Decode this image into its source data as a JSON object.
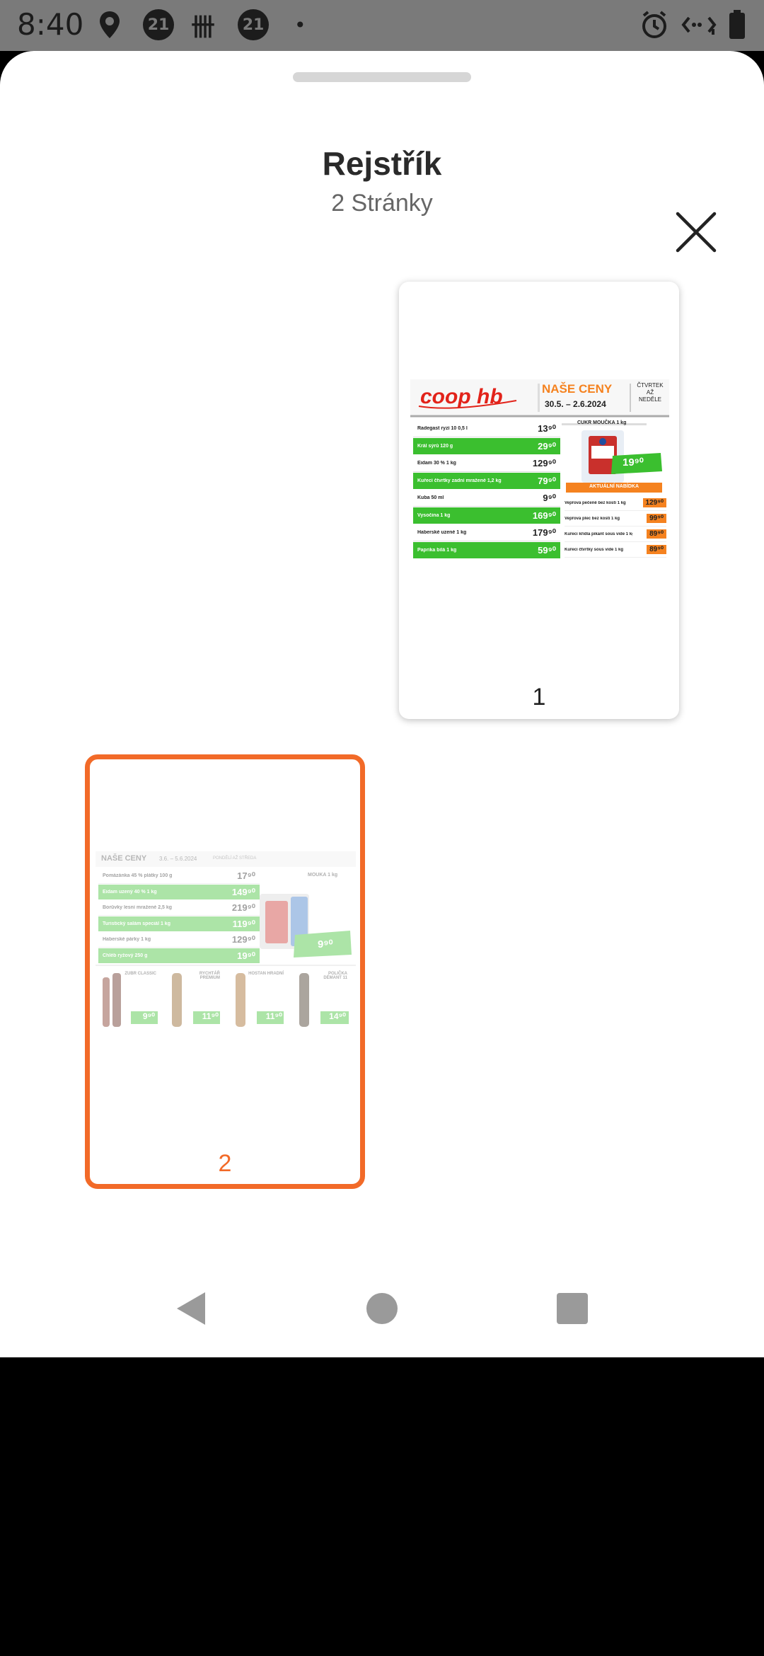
{
  "status_bar": {
    "time": "8:40",
    "notification_icons": [
      "location-pin-icon",
      "badge-21-icon",
      "tally-icon",
      "badge-21-icon",
      "dot-icon"
    ],
    "badge_text": "21",
    "tally_glyph": "卌",
    "dot_glyph": "•",
    "system_icons": [
      "alarm-icon",
      "data-sync-icon",
      "battery-icon"
    ]
  },
  "sheet": {
    "title": "Rejstřík",
    "subtitle": "2 Stránky",
    "close_icon": "close-icon"
  },
  "pages": [
    {
      "number": "1",
      "selected": false,
      "flyer": {
        "brand": "coop hb",
        "headline": "NAŠE CENY",
        "dates": "30.5. – 2.6.2024",
        "days": [
          "ČTVRTEK",
          "AŽ",
          "NEDĚLE"
        ],
        "items": [
          {
            "name": "Radegast ryzí 10 0,5 l",
            "price": "13⁹⁰",
            "green": false
          },
          {
            "name": "Král sýrů 120 g",
            "price": "29⁹⁰",
            "green": true
          },
          {
            "name": "Eidam 30 % 1 kg",
            "price": "129⁹⁰",
            "green": false
          },
          {
            "name": "Kuřecí čtvrtky zadní mražené 1,2 kg",
            "price": "79⁹⁰",
            "green": true
          },
          {
            "name": "Kuba 50 ml",
            "price": "9⁹⁰",
            "green": false
          },
          {
            "name": "Vysočina 1 kg",
            "price": "169⁹⁰",
            "green": true
          },
          {
            "name": "Haberské uzené 1 kg",
            "price": "179⁹⁰",
            "green": false
          },
          {
            "name": "Paprika bílá 1 kg",
            "price": "59⁹⁰",
            "green": true
          }
        ],
        "promo_title": "CUKR MOUČKA 1 kg",
        "promo_price": "19⁹⁰",
        "offer_title": "AKTUÁLNÍ NABÍDKA",
        "offers": [
          {
            "name": "Vepřová pečeně bez kosti 1 kg",
            "price": "129⁹⁰"
          },
          {
            "name": "Vepřová plec bez kosti 1 kg",
            "price": "99⁹⁰"
          },
          {
            "name": "Kuřecí křídla pikant sous vide 1 kg",
            "price": "89⁹⁰"
          },
          {
            "name": "Kuřecí čtvrtky sous vide 1 kg",
            "price": "89⁹⁰"
          }
        ]
      }
    },
    {
      "number": "2",
      "selected": true,
      "flyer": {
        "headline": "NAŠE CENY",
        "dates": "3.6. – 5.6.2024",
        "days": "PONDĚLÍ AŽ STŘEDA",
        "items": [
          {
            "name": "Pomázánka 45 % plátky 100 g",
            "price": "17⁹⁰",
            "green": false
          },
          {
            "name": "Eidam uzený 40 % 1 kg",
            "price": "149⁹⁰",
            "green": true
          },
          {
            "name": "Borůvky lesní mražené 2,5 kg",
            "price": "219⁹⁰",
            "green": false
          },
          {
            "name": "Turistický salám speciál 1 kg",
            "price": "119⁹⁰",
            "green": true
          },
          {
            "name": "Haberské párky 1 kg",
            "price": "129⁹⁰",
            "green": false
          },
          {
            "name": "Chléb ryžový 250 g",
            "price": "19⁹⁰",
            "green": true
          }
        ],
        "promo_title": "MOUKA 1 kg",
        "promo_price": "9⁹⁰",
        "beers": [
          {
            "name": "ZUBR CLASSIC",
            "price": "9⁹⁰"
          },
          {
            "name": "RYCHTÁŘ PREMIUM",
            "price": "11⁹⁰"
          },
          {
            "name": "HOSTAN HRADNÍ",
            "price": "11⁹⁰"
          },
          {
            "name": "POLIČKA DÉMANT 11",
            "price": "14⁹⁰"
          }
        ]
      }
    }
  ],
  "colors": {
    "accent": "#f26a28",
    "flyer_green": "#3bbf2f",
    "flyer_orange": "#f5821f",
    "coop_red": "#e2231a"
  },
  "nav_bar": {
    "buttons": [
      "back-icon",
      "home-icon",
      "recents-icon"
    ]
  }
}
